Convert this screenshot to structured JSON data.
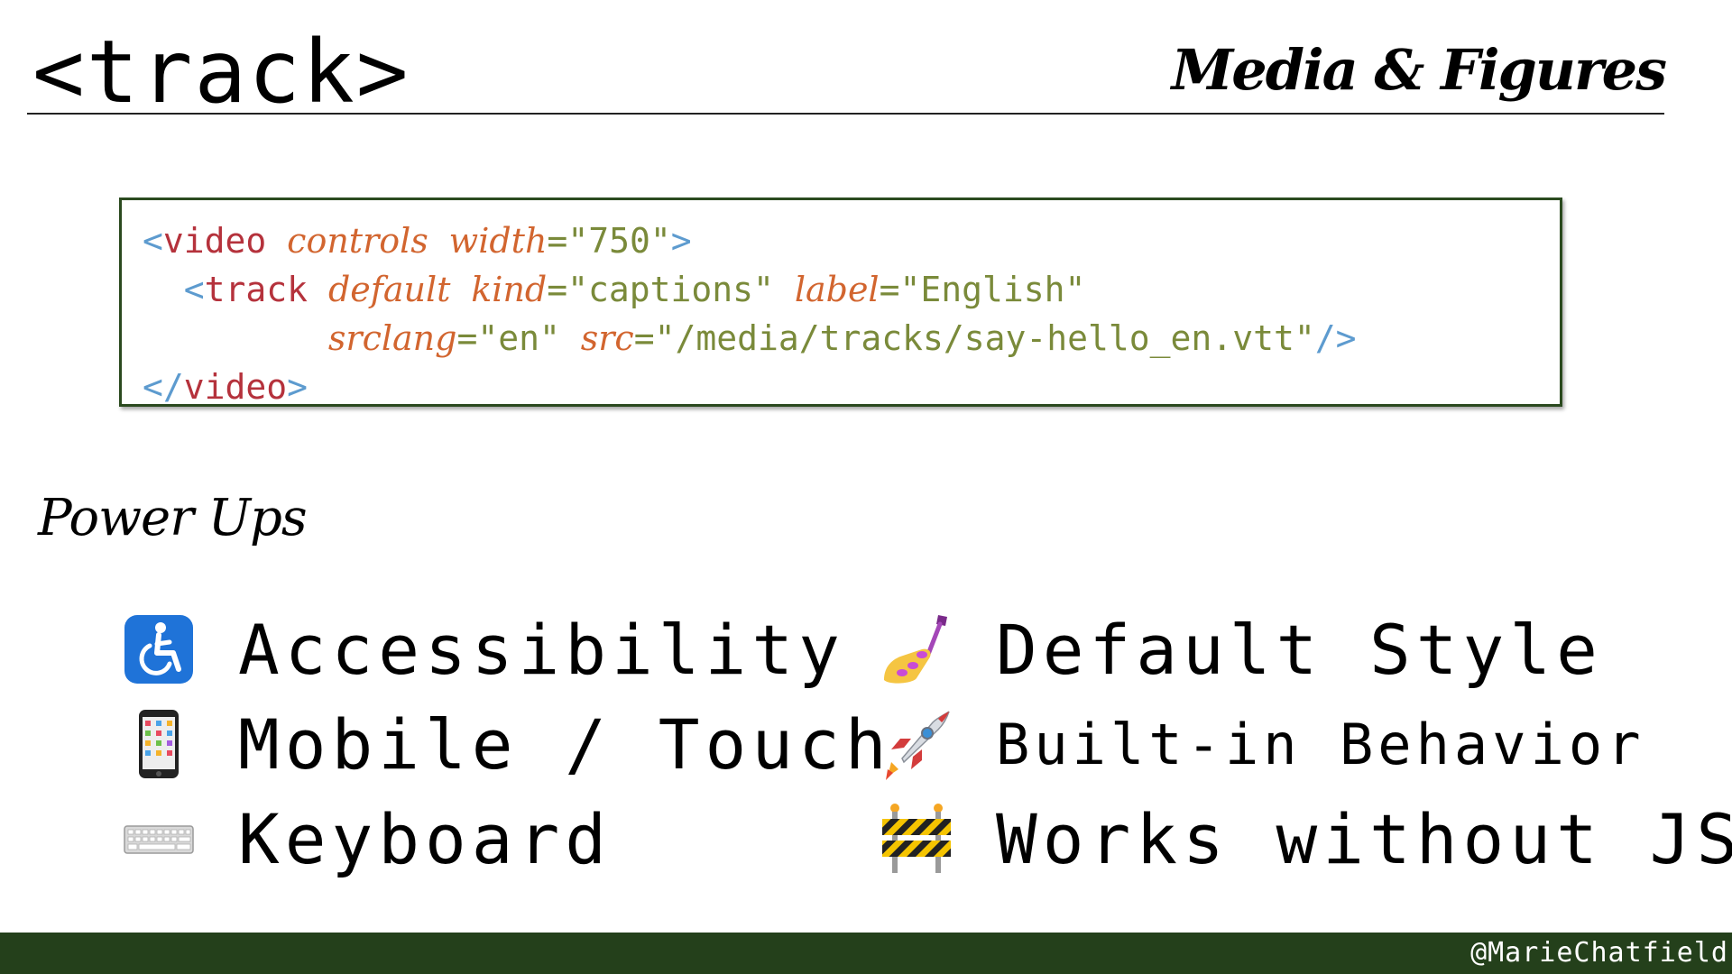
{
  "slide": {
    "title": "<track>",
    "section": "Media & Figures",
    "subheading": "Power Ups",
    "handle": "@MarieChatfield"
  },
  "code": {
    "line1": {
      "open": "<",
      "tag": "video",
      "attr1": "controls",
      "attr2": "width",
      "eq": "=",
      "val": "\"750\"",
      "close": ">"
    },
    "line2": {
      "indent": "  ",
      "open": "<",
      "tag": "track",
      "attr1": "default",
      "attr2": "kind",
      "eq": "=",
      "val1": "\"captions\"",
      "attr3": "label",
      "val2": "\"English\""
    },
    "line3": {
      "indent": "         ",
      "attr1": "srclang",
      "eq": "=",
      "val1": "\"en\"",
      "attr2": "src",
      "val2": "\"/media/tracks/say-hello_en.vtt\"",
      "close": "/>"
    },
    "line4": {
      "open": "</",
      "tag": "video",
      "close": ">"
    }
  },
  "features": {
    "left": [
      {
        "icon": "wheelchair-icon",
        "label": "Accessibility"
      },
      {
        "icon": "mobile-phone-icon",
        "label": "Mobile / Touch"
      },
      {
        "icon": "keyboard-icon",
        "label": "Keyboard"
      }
    ],
    "right": [
      {
        "icon": "nail-polish-icon",
        "label": "Default Style"
      },
      {
        "icon": "rocket-icon",
        "label": "Built-in Behavior"
      },
      {
        "icon": "construction-barrier-icon",
        "label": "Works without JS"
      }
    ]
  },
  "colors": {
    "footer": "#24401b",
    "code_border": "#2b4a1f",
    "punct": "#5d9bcf",
    "tag": "#b5323c",
    "attr": "#d2652f",
    "string": "#7a8a3a"
  }
}
